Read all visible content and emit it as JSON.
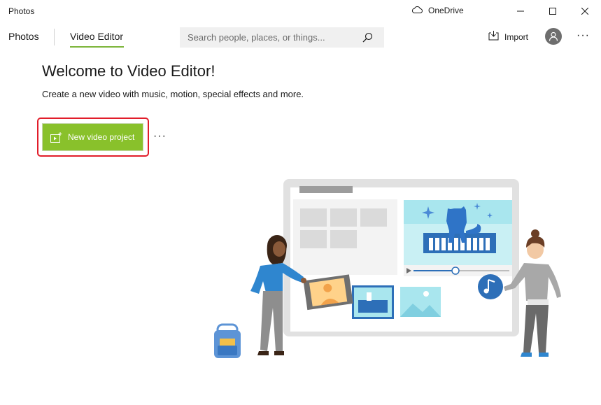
{
  "window": {
    "title": "Photos",
    "onedrive_label": "OneDrive"
  },
  "nav": {
    "tabs": [
      {
        "label": "Photos",
        "active": false
      },
      {
        "label": "Video Editor",
        "active": true
      }
    ],
    "search": {
      "placeholder": "Search people, places, or things...",
      "value": ""
    },
    "import_label": "Import",
    "more_label": "···"
  },
  "main": {
    "heading": "Welcome to Video Editor!",
    "subtitle": "Create a new video with music, motion, special effects and more.",
    "new_project_label": "New video project",
    "more_options_label": "···"
  },
  "colors": {
    "accent": "#7db53b",
    "button_bg": "#89c12b",
    "highlight_border": "#e11d2a"
  },
  "icons": {
    "onedrive": "cloud-icon",
    "search": "search-icon",
    "import": "import-icon",
    "avatar": "person-icon",
    "new_project": "video-project-icon"
  }
}
